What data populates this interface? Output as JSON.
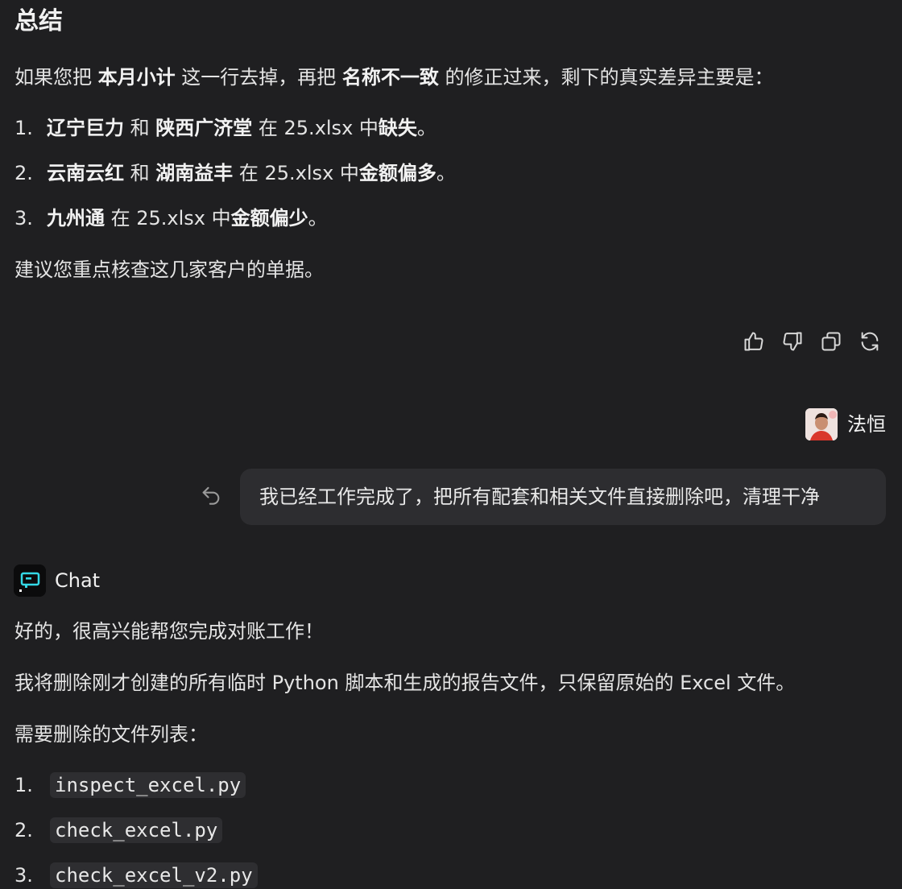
{
  "summary": {
    "heading": "总结",
    "intro": {
      "p1": "如果您把 ",
      "b1": "本月小计",
      "p2": " 这一行去掉，再把 ",
      "b2": "名称不一致",
      "p3": " 的修正过来，剩下的真实差异主要是："
    },
    "items": [
      {
        "num": "1.",
        "b1": "辽宁巨力",
        "t1": " 和 ",
        "b2": "陕西广济堂",
        "t2": " 在 25.xlsx 中",
        "b3": "缺失",
        "t3": "。"
      },
      {
        "num": "2.",
        "b1": "云南云红",
        "t1": " 和 ",
        "b2": "湖南益丰",
        "t2": " 在 25.xlsx 中",
        "b3": "金额偏多",
        "t3": "。"
      },
      {
        "num": "3.",
        "b1": "九州通",
        "t1": " 在 25.xlsx 中",
        "b2": "",
        "t2": "",
        "b3": "金额偏少",
        "t3": "。"
      }
    ],
    "advice": "建议您重点核查这几家客户的单据。"
  },
  "actions": {
    "like": "thumbs-up-icon",
    "dislike": "thumbs-down-icon",
    "copy": "copy-icon",
    "regenerate": "refresh-icon"
  },
  "user": {
    "name": "法恒",
    "message": "我已经工作完成了，把所有配套和相关文件直接删除吧，清理干净"
  },
  "bot": {
    "name": "Chat",
    "p1": "好的，很高兴能帮您完成对账工作！",
    "p2": "我将删除刚才创建的所有临时 Python 脚本和生成的报告文件，只保留原始的 Excel 文件。",
    "p3": "需要删除的文件列表：",
    "files": [
      {
        "num": "1.",
        "name": "inspect_excel.py"
      },
      {
        "num": "2.",
        "name": "check_excel.py"
      },
      {
        "num": "3.",
        "name": "check_excel_v2.py"
      }
    ]
  }
}
